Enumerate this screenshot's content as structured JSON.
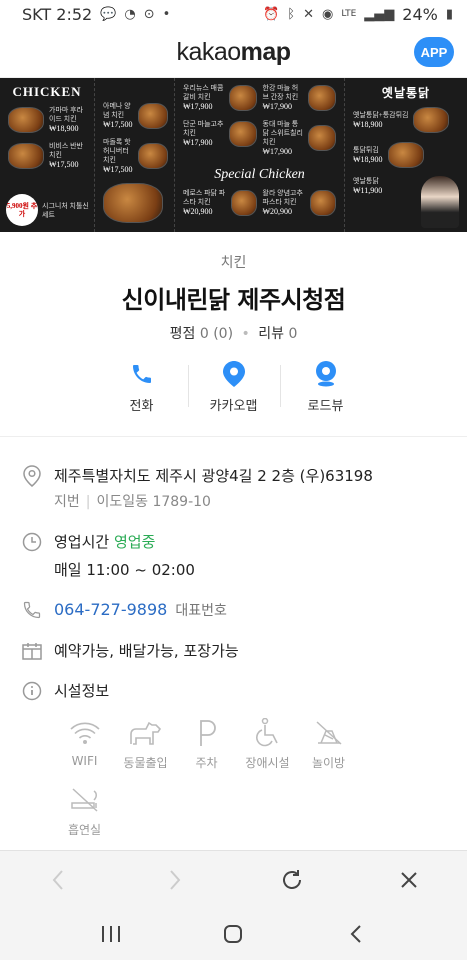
{
  "status_bar": {
    "carrier_time": "SKT 2:52",
    "network": "LTE",
    "battery": "24%"
  },
  "header": {
    "logo_light": "kakao",
    "logo_bold": "map",
    "app_button": "APP"
  },
  "banner": {
    "left_title": "CHICKEN",
    "middle_script": "Special Chicken",
    "right_title": "옛날통닭",
    "left_items": [
      {
        "name": "가마마 후라이드 치킨",
        "price": "₩18,900"
      },
      {
        "name": "비비스 반반 치킨",
        "price": "₩17,500"
      },
      {
        "name": "시그니처 치톨신 세트",
        "price": ""
      }
    ],
    "mid_left_items": [
      {
        "name": "아메나 양념 치킨",
        "price": "₩17,500"
      },
      {
        "name": "마돌록 핫 허니버터 치킨",
        "price": "₩17,500"
      }
    ],
    "mid_items": [
      {
        "name": "우리뉴스 매콤갈비 치킨",
        "price": "₩17,900"
      },
      {
        "name": "단군 마늘고추 치킨",
        "price": "₩17,900"
      },
      {
        "name": "메로스 파닭 파스타 치킨",
        "price": "₩20,900"
      }
    ],
    "mid_right_items": [
      {
        "name": "한강 마늘 허브 간장 치킨",
        "price": "₩17,900"
      },
      {
        "name": "동대 마늘 통닭 스위트칠리 치킨",
        "price": "₩17,900"
      },
      {
        "name": "왈라 양념고추 파스타 치킨",
        "price": "₩20,900"
      }
    ],
    "right_items": [
      {
        "name": "옛날통닭+통감튀김",
        "price": "₩18,900"
      },
      {
        "name": "통닭튀김",
        "price": "₩18,900"
      },
      {
        "name": "옛날통닭",
        "price": "₩11,900"
      }
    ],
    "badge": "5,900원 추가"
  },
  "place": {
    "category": "치킨",
    "name": "신이내린닭 제주시청점",
    "rating_label": "평점",
    "rating_value": "0 (0)",
    "review_label": "리뷰",
    "review_value": "0"
  },
  "actions": [
    {
      "label": "전화",
      "icon": "phone-icon"
    },
    {
      "label": "카카오맵",
      "icon": "map-pin-icon"
    },
    {
      "label": "로드뷰",
      "icon": "roadview-icon"
    }
  ],
  "details": {
    "address": "제주특별자치도 제주시 광양4길 2 2층 (우)63198",
    "lot_label": "지번",
    "lot_address": "이도일동 1789-10",
    "hours_label": "영업시간",
    "hours_status": "영업중",
    "hours": "매일 11:00 ~ 02:00",
    "phone": "064-727-9898",
    "phone_note": "대표번호",
    "services": "예약가능, 배달가능, 포장가능",
    "facility_title": "시설정보"
  },
  "facilities": [
    {
      "label": "WIFI",
      "icon": "wifi-icon"
    },
    {
      "label": "동물출입",
      "icon": "dog-icon"
    },
    {
      "label": "주차",
      "icon": "parking-icon"
    },
    {
      "label": "장애시설",
      "icon": "wheelchair-icon"
    },
    {
      "label": "놀이방",
      "icon": "playroom-icon"
    },
    {
      "label": "흡연실",
      "icon": "smoking-room-icon"
    }
  ],
  "colors": {
    "accent_blue": "#2d8ff7",
    "open_green": "#2bab55",
    "phone_blue": "#2b6cc4"
  }
}
